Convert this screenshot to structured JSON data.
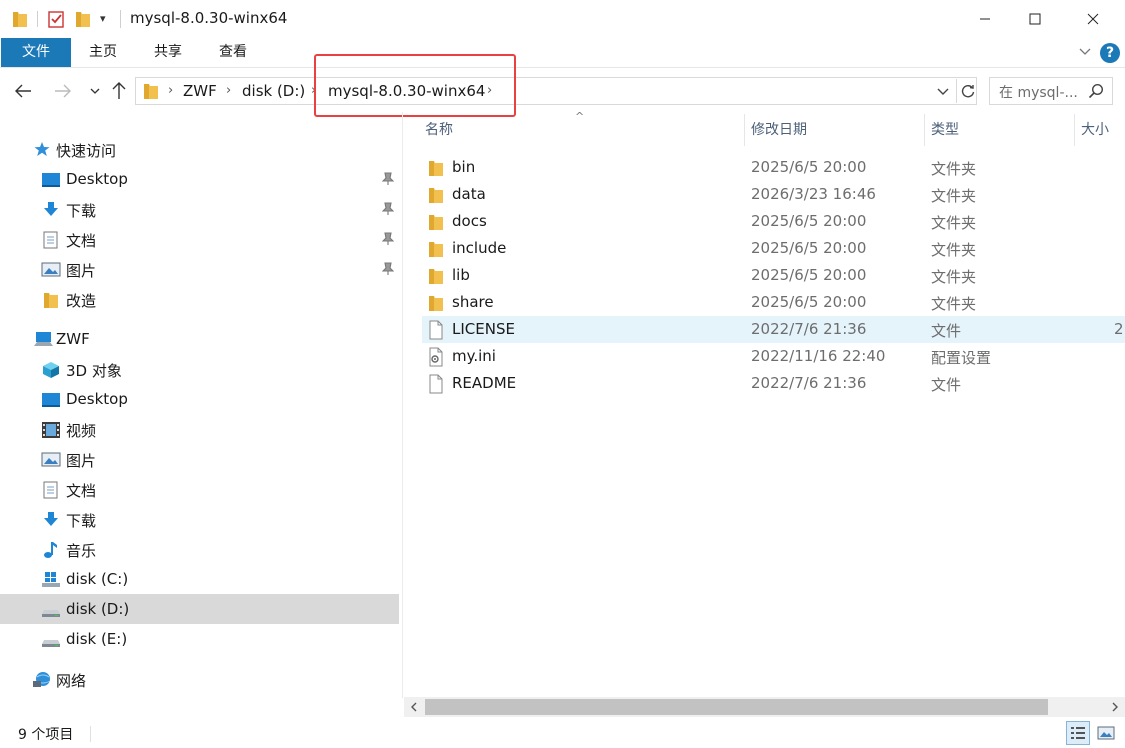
{
  "window": {
    "title": "mysql-8.0.30-winx64",
    "quick_access_dropdown": "▾"
  },
  "ribbon": {
    "tabs": [
      {
        "label": "文件",
        "active": true
      },
      {
        "label": "主页"
      },
      {
        "label": "共享"
      },
      {
        "label": "查看"
      }
    ],
    "help": "?"
  },
  "address": {
    "crumbs": [
      "ZWF",
      "disk (D:)",
      "mysql-8.0.30-winx64"
    ]
  },
  "search": {
    "placeholder": "在 mysql-..."
  },
  "sidebar": {
    "items": [
      {
        "label": "快速访问",
        "icon": "star-icon"
      },
      {
        "label": "Desktop",
        "icon": "desktop-icon",
        "pinned": true
      },
      {
        "label": "下载",
        "icon": "download-icon",
        "pinned": true
      },
      {
        "label": "文档",
        "icon": "document-icon",
        "pinned": true
      },
      {
        "label": "图片",
        "icon": "picture-icon",
        "pinned": true
      },
      {
        "label": "改造",
        "icon": "folder-icon"
      },
      {
        "label": "ZWF",
        "icon": "computer-icon"
      },
      {
        "label": "3D 对象",
        "icon": "cube-icon"
      },
      {
        "label": "Desktop",
        "icon": "desktop-icon"
      },
      {
        "label": "视频",
        "icon": "video-icon"
      },
      {
        "label": "图片",
        "icon": "picture-icon"
      },
      {
        "label": "文档",
        "icon": "document-icon"
      },
      {
        "label": "下载",
        "icon": "download-icon"
      },
      {
        "label": "音乐",
        "icon": "music-icon"
      },
      {
        "label": "disk (C:)",
        "icon": "windows-drive-icon"
      },
      {
        "label": "disk (D:)",
        "icon": "drive-icon",
        "selected": true
      },
      {
        "label": "disk (E:)",
        "icon": "drive-icon"
      },
      {
        "label": "网络",
        "icon": "network-icon"
      }
    ]
  },
  "columns": {
    "name": "名称",
    "date": "修改日期",
    "type": "类型",
    "size": "大小"
  },
  "files": [
    {
      "name": "bin",
      "date": "2025/6/5 20:00",
      "type": "文件夹",
      "icon": "folder-icon"
    },
    {
      "name": "data",
      "date": "2026/3/23 16:46",
      "type": "文件夹",
      "icon": "folder-icon"
    },
    {
      "name": "docs",
      "date": "2025/6/5 20:00",
      "type": "文件夹",
      "icon": "folder-icon"
    },
    {
      "name": "include",
      "date": "2025/6/5 20:00",
      "type": "文件夹",
      "icon": "folder-icon"
    },
    {
      "name": "lib",
      "date": "2025/6/5 20:00",
      "type": "文件夹",
      "icon": "folder-icon"
    },
    {
      "name": "share",
      "date": "2025/6/5 20:00",
      "type": "文件夹",
      "icon": "folder-icon"
    },
    {
      "name": "LICENSE",
      "date": "2022/7/6 21:36",
      "type": "文件",
      "size": "2",
      "icon": "file-icon",
      "hover": true
    },
    {
      "name": "my.ini",
      "date": "2022/11/16 22:40",
      "type": "配置设置",
      "icon": "config-file-icon"
    },
    {
      "name": "README",
      "date": "2022/7/6 21:36",
      "type": "文件",
      "icon": "file-icon"
    }
  ],
  "status": {
    "item_count": "9 个项目"
  },
  "colors": {
    "accent": "#1b79b8",
    "folder": "#f2c04e",
    "hover_row": "#e5f3fb",
    "selected_nav": "#d9d9d9",
    "highlight": "#e8413f"
  }
}
